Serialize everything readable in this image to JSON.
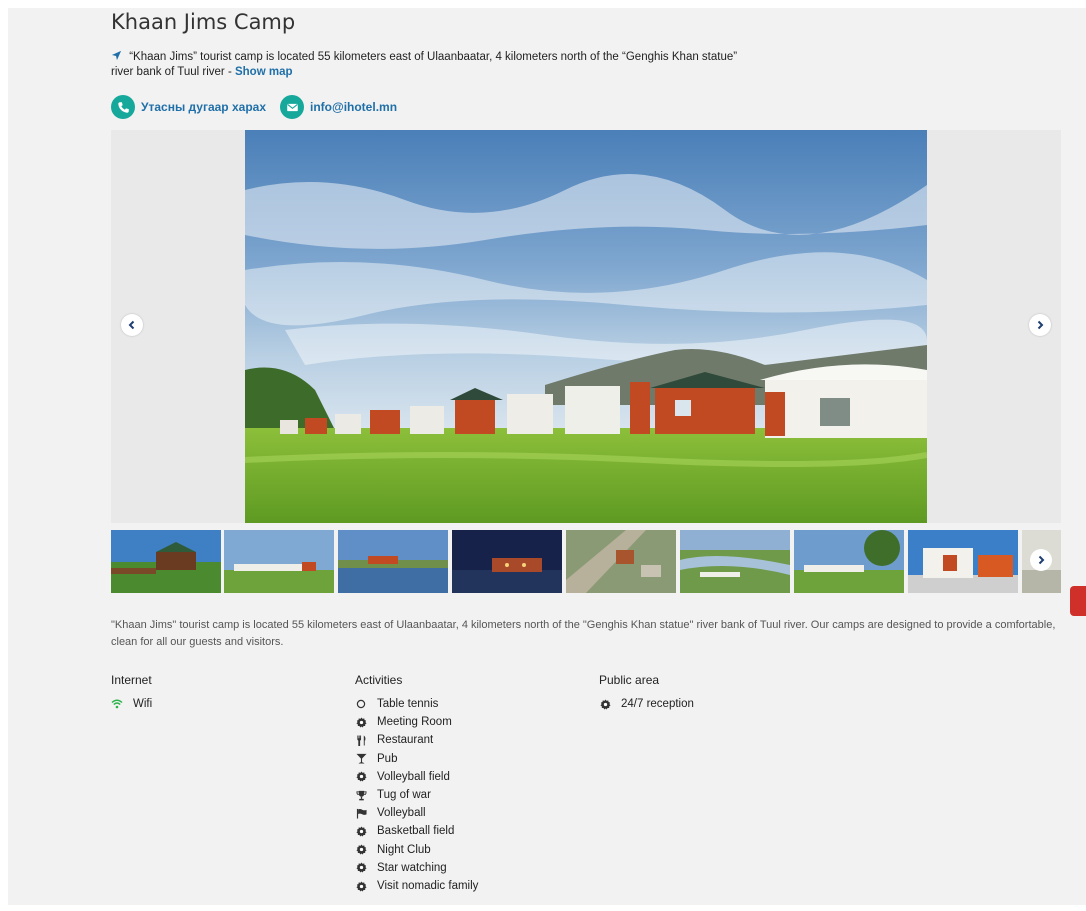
{
  "hotel": {
    "name": "Khaan Jims Camp",
    "address": "“Khaan Jims” tourist camp is located 55 kilometers east of Ulaanbaatar, 4 kilometers north of the “Genghis Khan statue” river bank of Tuul river - ",
    "show_map": "Show map",
    "phone_label": "Утасны дугаар харах",
    "email": "info@ihotel.mn"
  },
  "description": "\"Khaan Jims\" tourist camp is located 55 kilometers east of Ulaanbaatar, 4 kilometers north of the \"Genghis Khan statue\" river bank of Tuul river. Our camps are designed to provide a comfortable, clean  for all our guests and visitors.",
  "amenities": {
    "internet": {
      "heading": "Internet",
      "items": [
        {
          "label": "Wifi",
          "icon": "wifi-icon"
        }
      ]
    },
    "activities": {
      "heading": "Activities",
      "items": [
        {
          "label": "Table tennis",
          "icon": "circle-icon"
        },
        {
          "label": "Meeting Room",
          "icon": "gear-icon"
        },
        {
          "label": "Restaurant",
          "icon": "cutlery-icon"
        },
        {
          "label": "Pub",
          "icon": "cocktail-icon"
        },
        {
          "label": "Volleyball field",
          "icon": "gear-icon"
        },
        {
          "label": "Tug of war",
          "icon": "trophy-icon"
        },
        {
          "label": "Volleyball",
          "icon": "flag-icon"
        },
        {
          "label": "Basketball field",
          "icon": "gear-icon"
        },
        {
          "label": "Night Club",
          "icon": "gear-icon"
        },
        {
          "label": "Star watching",
          "icon": "gear-icon"
        },
        {
          "label": "Visit nomadic family",
          "icon": "gear-icon"
        }
      ]
    },
    "public_area": {
      "heading": "Public area",
      "items": [
        {
          "label": "24/7 reception",
          "icon": "gear-icon"
        }
      ]
    }
  },
  "colors": {
    "accent_teal": "#17a89c",
    "link_blue": "#1f6fa8",
    "wifi_green": "#2bb24c"
  }
}
